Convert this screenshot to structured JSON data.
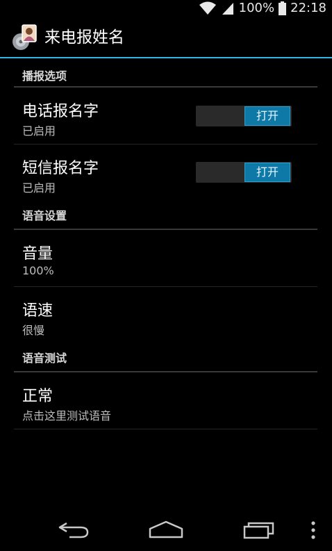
{
  "status_bar": {
    "battery_percent": "100%",
    "time": "22:18",
    "icons": [
      "wifi-icon",
      "signal-icon",
      "battery-icon"
    ]
  },
  "action_bar": {
    "title": "来电报姓名",
    "icon": "app-icon",
    "accent_color": "#33b5e5"
  },
  "sections": [
    {
      "header": "播报选项",
      "items": [
        {
          "title": "电话报名字",
          "summary": "已启用",
          "switch_label": "打开"
        },
        {
          "title": "短信报名字",
          "summary": "已启用",
          "switch_label": "打开"
        }
      ]
    },
    {
      "header": "语音设置",
      "items": [
        {
          "title": "音量",
          "summary": "100%"
        },
        {
          "title": "语速",
          "summary": "很慢"
        }
      ]
    },
    {
      "header": "语音测试",
      "items": [
        {
          "title": "正常",
          "summary": "点击这里测试语音"
        }
      ]
    }
  ],
  "nav_bar": {
    "icons": [
      "back-icon",
      "home-icon",
      "recent-apps-icon",
      "overflow-menu-icon"
    ]
  }
}
